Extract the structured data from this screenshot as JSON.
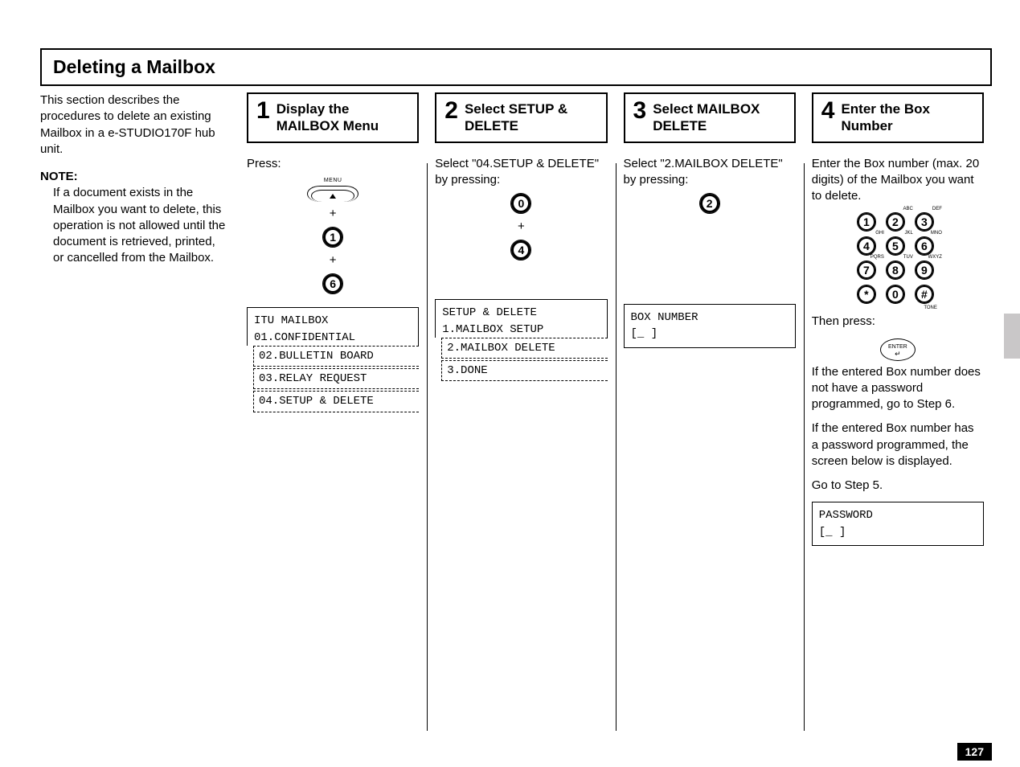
{
  "title": "Deleting a Mailbox",
  "intro": "This section describes the procedures to delete an existing Mailbox in a e-STUDIO170F hub unit.",
  "note_heading": "NOTE:",
  "note_body": "If a document exists in the Mailbox you want to delete, this operation is not allowed until the document is retrieved, printed, or cancelled from the Mailbox.",
  "steps": {
    "s1": {
      "num": "1",
      "title": "Display the MAILBOX Menu",
      "body": "Press:",
      "menu_label": "MENU",
      "keys": [
        "1",
        "6"
      ],
      "lcd_top": [
        "ITU MAILBOX",
        "01.CONFIDENTIAL"
      ],
      "lcd_rows": [
        "02.BULLETIN BOARD",
        "03.RELAY REQUEST",
        "04.SETUP & DELETE"
      ]
    },
    "s2": {
      "num": "2",
      "title": "Select SETUP & DELETE",
      "body": "Select \"04.SETUP & DELETE\" by pressing:",
      "keys": [
        "0",
        "4"
      ],
      "lcd_top": [
        "SETUP & DELETE",
        "1.MAILBOX SETUP"
      ],
      "lcd_rows": [
        "2.MAILBOX DELETE",
        "3.DONE"
      ]
    },
    "s3": {
      "num": "3",
      "title": "Select  MAILBOX DELETE",
      "body": "Select \"2.MAILBOX DELETE\" by pressing:",
      "keys": [
        "2"
      ],
      "lcd_top": [
        "BOX NUMBER",
        "[_               ]"
      ]
    },
    "s4": {
      "num": "4",
      "title": "Enter the Box Number",
      "body": "Enter the Box number (max. 20 digits) of the Mailbox you want to delete.",
      "keypad": [
        "1",
        "2",
        "3",
        "4",
        "5",
        "6",
        "7",
        "8",
        "9",
        "*",
        "0",
        "#"
      ],
      "keypad_sup": [
        "",
        "ABC",
        "DEF",
        "GHI",
        "JKL",
        "MNO",
        "PQRS",
        "TUV",
        "WXYZ",
        "",
        "",
        "TONE"
      ],
      "tone": "TONE",
      "then_press": "Then press:",
      "enter": "ENTER",
      "para1": "If the entered Box number does not have a password programmed, go to Step 6.",
      "para2": "If the entered Box number has a password programmed, the screen below is displayed.",
      "para3": "Go to Step 5.",
      "lcd": [
        "PASSWORD",
        "[_               ]"
      ]
    }
  },
  "page_number": "127"
}
